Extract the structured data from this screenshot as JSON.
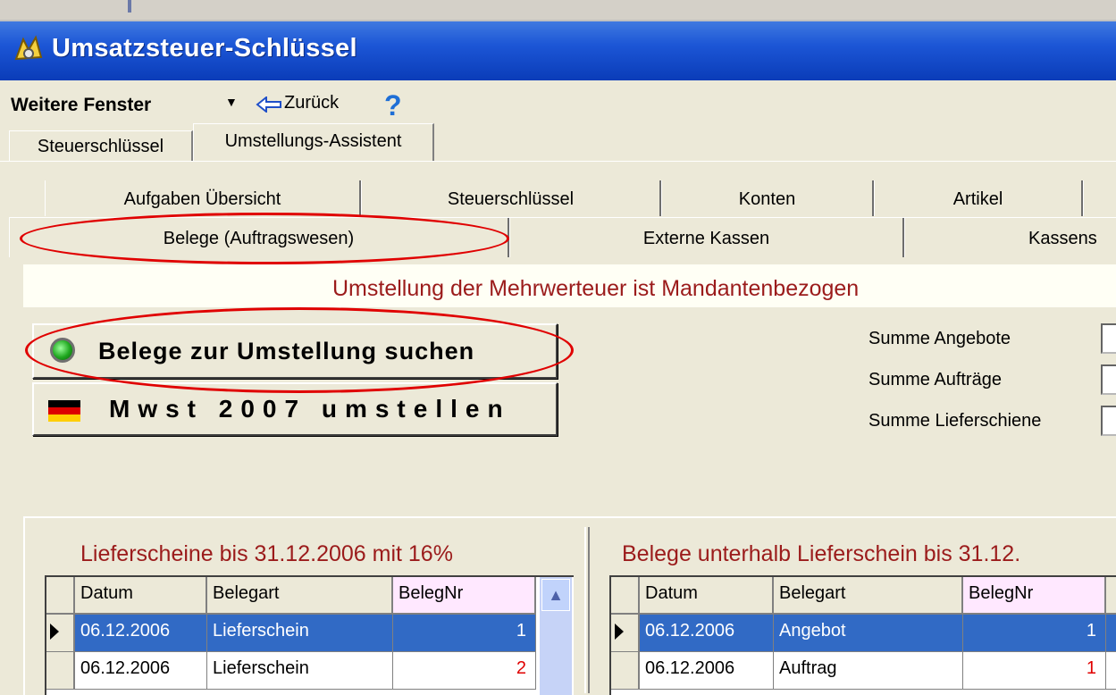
{
  "window": {
    "title": "Umsatzsteuer-Schlüssel"
  },
  "toolbar": {
    "more_windows": "Weitere Fenster",
    "back": "Zurück",
    "help": "?"
  },
  "outer_tabs": [
    {
      "label": "Steuerschlüssel",
      "active": false
    },
    {
      "label": "Umstellungs-Assistent",
      "active": true
    }
  ],
  "inner_tabs_row1": [
    "Aufgaben Übersicht",
    "Steuerschlüssel",
    "Konten",
    "Artikel"
  ],
  "inner_tabs_row2": [
    "Belege (Auftragswesen)",
    "Externe Kassen",
    "Kassens"
  ],
  "banner": "Umstellung der Mehrwerteuer ist Mandantenbezogen",
  "buttons": {
    "search": "Belege zur Umstellung suchen",
    "convert": "Mwst 2007 umstellen"
  },
  "sums": [
    "Summe Angebote",
    "Summe Aufträge",
    "Summe Lieferschiene"
  ],
  "left_grid": {
    "title": "Lieferscheine bis 31.12.2006  mit 16%",
    "columns": [
      "Datum",
      "Belegart",
      "BelegNr"
    ],
    "rows": [
      {
        "datum": "06.12.2006",
        "belegart": "Lieferschein",
        "belegnr": "1"
      },
      {
        "datum": "06.12.2006",
        "belegart": "Lieferschein",
        "belegnr": "2"
      }
    ]
  },
  "right_grid": {
    "title": "Belege unterhalb Lieferschein bis 31.12.",
    "columns": [
      "Datum",
      "Belegart",
      "BelegNr"
    ],
    "rows": [
      {
        "datum": "06.12.2006",
        "belegart": "Angebot",
        "belegnr": "1"
      },
      {
        "datum": "06.12.2006",
        "belegart": "Auftrag",
        "belegnr": "1"
      }
    ]
  },
  "colors": {
    "selection": "#316ac5",
    "banner_text": "#9b1b1b",
    "annotation": "#e00000"
  }
}
